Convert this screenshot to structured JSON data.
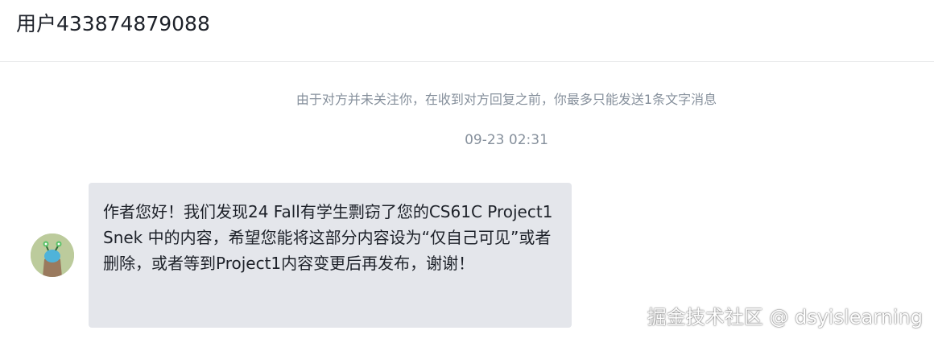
{
  "header": {
    "title": "用户433874879088"
  },
  "conversation": {
    "notice": "由于对方并未关注你，在收到对方回复之前，你最多只能发送1条文字消息",
    "timestamp": "09-23 02:31",
    "messages": [
      {
        "text": "作者您好！我们发现24 Fall有学生剽窃了您的CS61C Project1 Snek 中的内容，希望您能将这部分内容设为“仅自己可见”或者删除，或者等到Project1内容变更后再发布，谢谢！"
      }
    ]
  },
  "watermark": "掘金技术社区 @ dsyislearning",
  "colors": {
    "bubble_bg": "#e4e6eb",
    "muted_text": "#86909c",
    "primary_text": "#1d2129",
    "divider": "#e8e9eb"
  }
}
